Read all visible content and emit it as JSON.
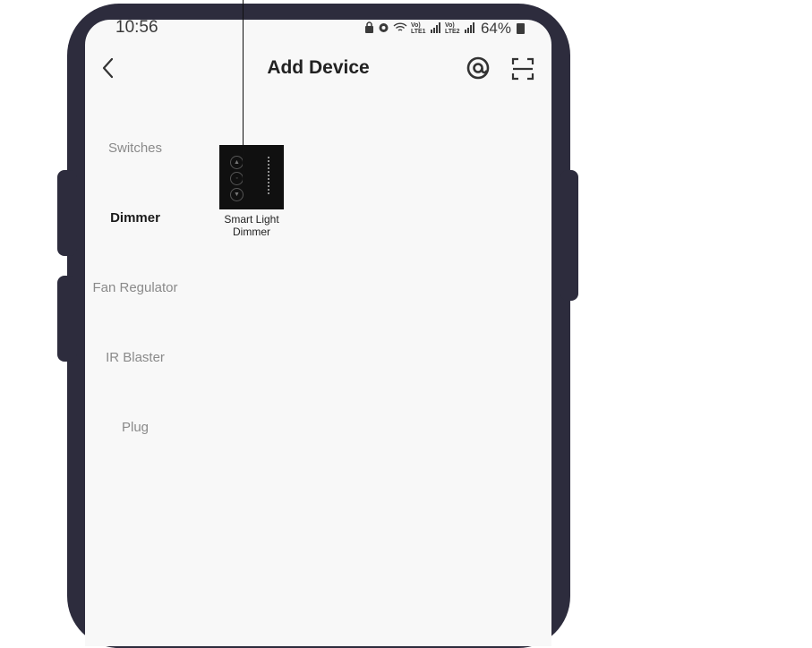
{
  "status_bar": {
    "time": "10:56",
    "sim1": "Vo) LTE1",
    "sim2": "Vo) LTE2",
    "battery": "64%"
  },
  "header": {
    "title": "Add Device",
    "back_icon": "chevron-left-icon",
    "at_icon": "at-sign-icon",
    "scan_icon": "scan-frame-icon"
  },
  "categories": [
    {
      "label": "Switches",
      "active": false
    },
    {
      "label": "Dimmer",
      "active": true
    },
    {
      "label": "Fan Regulator",
      "active": false
    },
    {
      "label": "IR Blaster",
      "active": false
    },
    {
      "label": "Plug",
      "active": false
    }
  ],
  "devices": [
    {
      "label_line1": "Smart Light",
      "label_line2": "Dimmer"
    }
  ],
  "colors": {
    "frame": "#2d2c3d",
    "screen": "#f8f8f8",
    "active_text": "#1a1a1a",
    "inactive_text": "#8a8a8a"
  }
}
